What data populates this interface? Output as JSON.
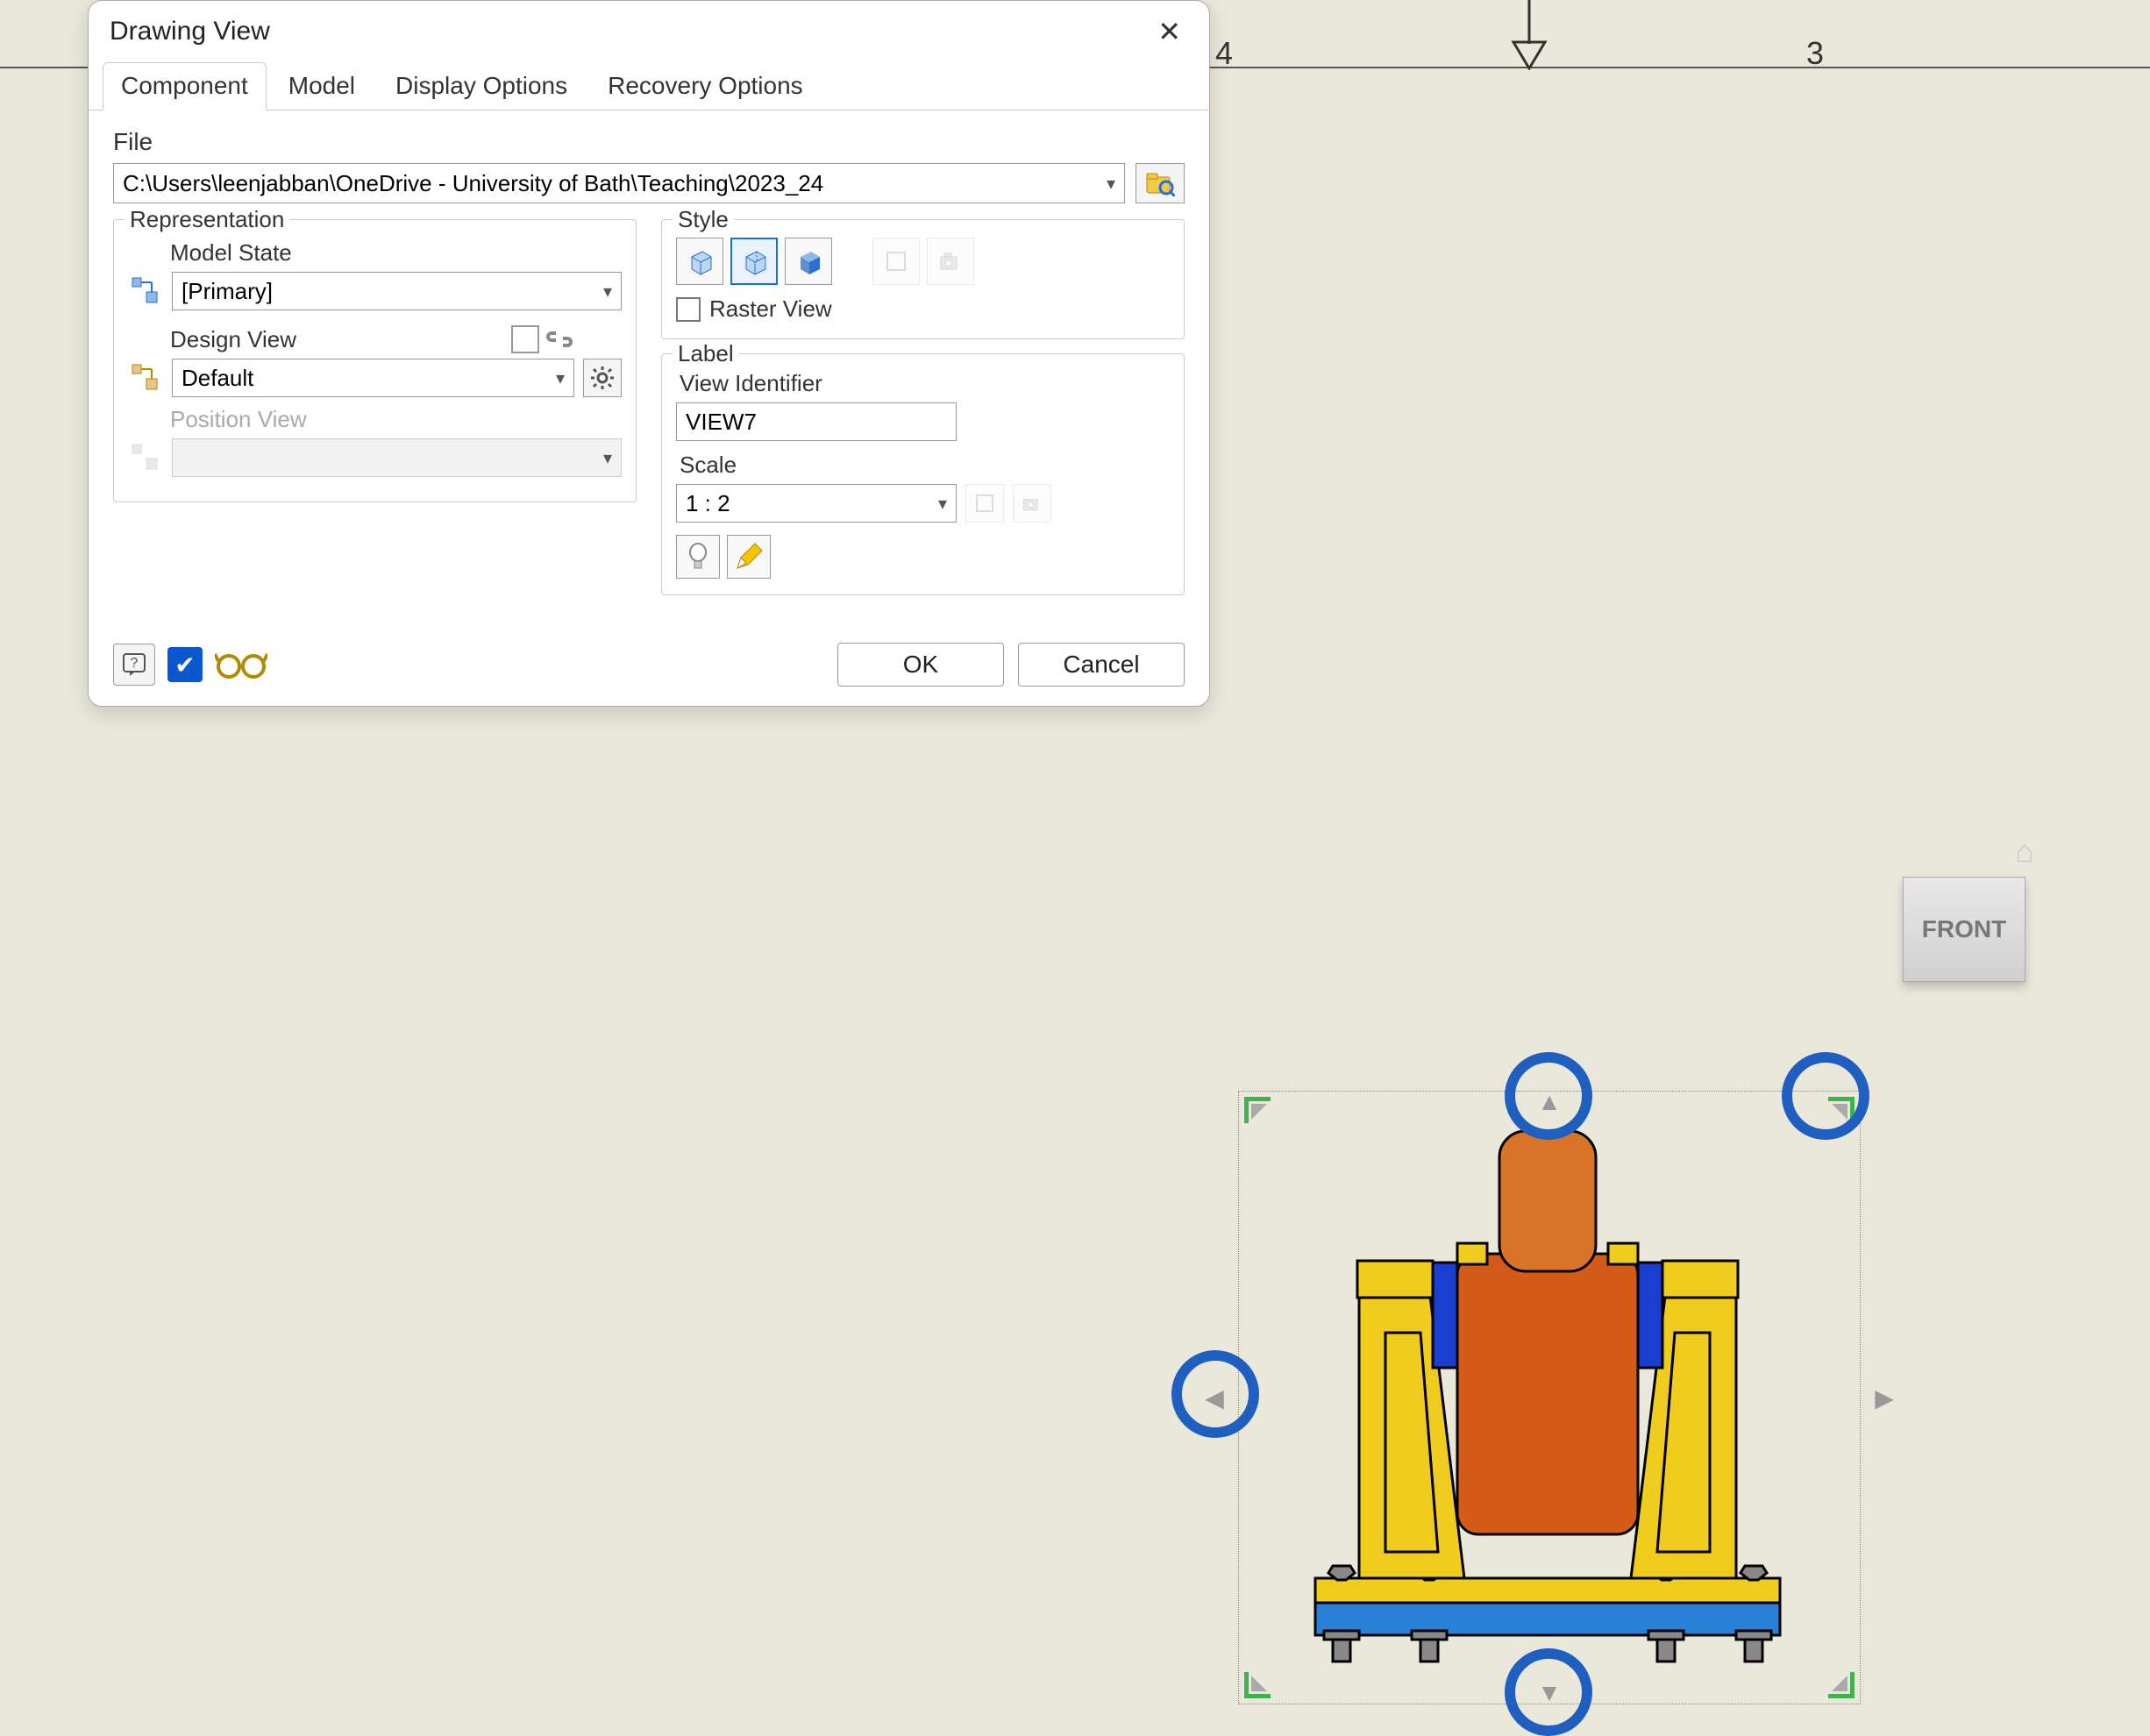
{
  "ruler": {
    "num4": "4",
    "num3": "3"
  },
  "dialog": {
    "title": "Drawing View",
    "tabs": {
      "component": "Component",
      "model": "Model",
      "display": "Display Options",
      "recovery": "Recovery Options"
    },
    "file_label": "File",
    "file_path": "C:\\Users\\leenjabban\\OneDrive - University of Bath\\Teaching\\2023_24",
    "representation": {
      "title": "Representation",
      "model_state_label": "Model State",
      "model_state_value": "[Primary]",
      "design_view_label": "Design View",
      "design_view_value": "Default",
      "position_view_label": "Position View",
      "position_view_value": ""
    },
    "style": {
      "title": "Style",
      "raster_label": "Raster View"
    },
    "label": {
      "title": "Label",
      "view_id_label": "View Identifier",
      "view_id_value": "VIEW7",
      "scale_label": "Scale",
      "scale_value": "1 : 2"
    },
    "buttons": {
      "ok": "OK",
      "cancel": "Cancel"
    }
  },
  "viewcube": {
    "face": "FRONT"
  }
}
